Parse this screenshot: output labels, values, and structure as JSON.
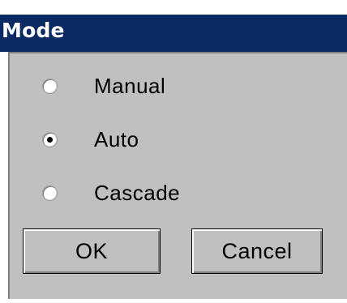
{
  "dialog": {
    "title": "Mode",
    "options": [
      {
        "label": "Manual",
        "selected": false
      },
      {
        "label": "Auto",
        "selected": true
      },
      {
        "label": "Cascade",
        "selected": false
      }
    ],
    "buttons": {
      "ok_label": "OK",
      "cancel_label": "Cancel"
    }
  },
  "colors": {
    "titlebar": "#0a2a63",
    "title_text": "#ffffff",
    "dialog_face": "#c0c0c0"
  }
}
